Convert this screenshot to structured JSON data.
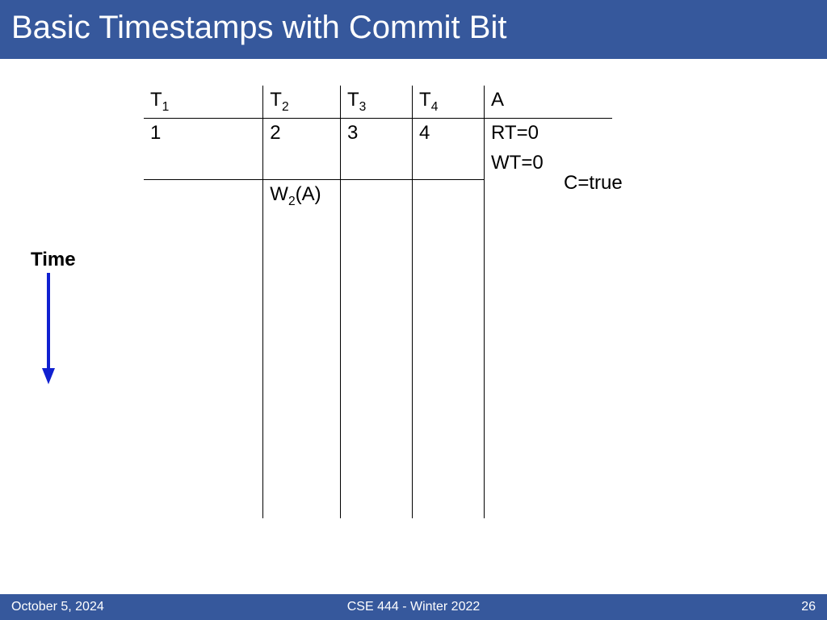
{
  "title": "Basic Timestamps with Commit Bit",
  "time_label": "Time",
  "table": {
    "headers": {
      "t1": "T",
      "t1_sub": "1",
      "t2": "T",
      "t2_sub": "2",
      "t3": "T",
      "t3_sub": "3",
      "t4": "T",
      "t4_sub": "4",
      "a": "A"
    },
    "row1": {
      "t1": "1",
      "t2": "2",
      "t3": "3",
      "t4": "4",
      "a": "RT=0"
    },
    "row2": {
      "a": "WT=0",
      "c_ext": "C=true"
    },
    "row3": {
      "t2_op": "W",
      "t2_sub": "2",
      "t2_arg": "(A)"
    }
  },
  "footer": {
    "left": "October 5, 2024",
    "center": "CSE 444 - Winter 2022",
    "right": "26"
  }
}
